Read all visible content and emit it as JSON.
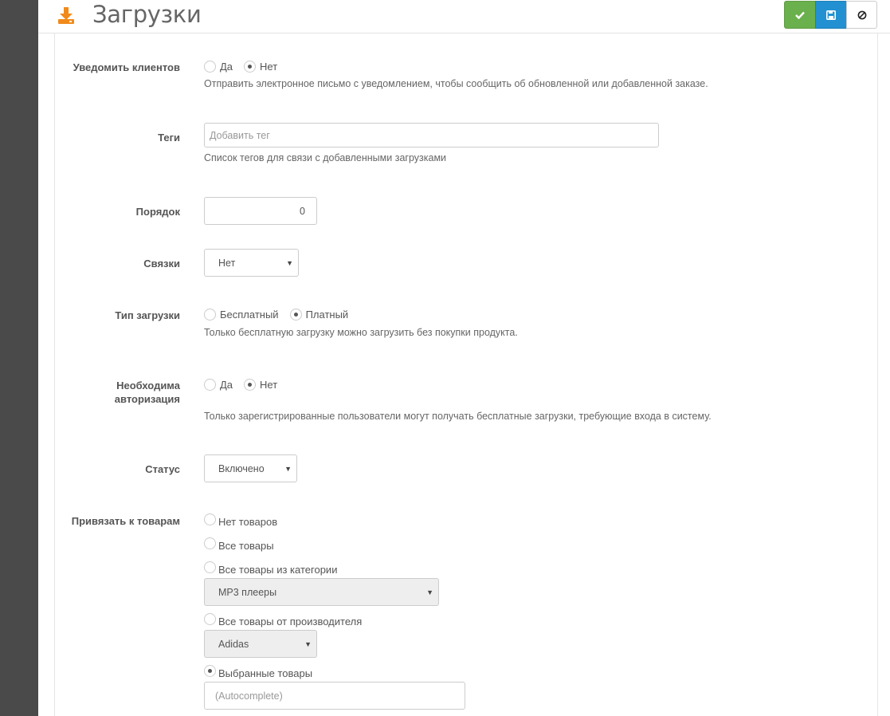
{
  "page": {
    "title": "Загрузки"
  },
  "toolbar": {
    "ok_icon": "check-icon",
    "save_icon": "floppy-icon",
    "cancel_icon": "ban-icon"
  },
  "colors": {
    "ok": "#6ab04c",
    "save": "#2391d1",
    "accent": "#f18a1a",
    "sidebar": "#4a4a4a"
  },
  "notify": {
    "label": "Уведомить клиентов",
    "yes": "Да",
    "no": "Нет",
    "selected": "no",
    "help": "Отправить электронное письмо с уведомлением, чтобы сообщить об обновленной или добавленной заказе."
  },
  "tags": {
    "label": "Теги",
    "placeholder": "Добавить тег",
    "help": "Список тегов для связи с добавленными загрузками"
  },
  "order": {
    "label": "Порядок",
    "value": "0"
  },
  "links": {
    "label": "Связки",
    "value": "Нет"
  },
  "type": {
    "label": "Тип загрузки",
    "free": "Бесплатный",
    "paid": "Платный",
    "selected": "paid",
    "help": "Только бесплатную загрузку можно загрузить без покупки продукта."
  },
  "auth": {
    "label_line1": "Необходима",
    "label_line2": "авторизация",
    "yes": "Да",
    "no": "Нет",
    "selected": "no",
    "help": "Только зарегистрированные пользователи могут получать бесплатные загрузки, требующие входа в систему."
  },
  "status": {
    "label": "Статус",
    "value": "Включено"
  },
  "products": {
    "label": "Привязать к товарам",
    "none": "Нет товаров",
    "all": "Все товары",
    "category": "Все товары из категории",
    "category_value": "MP3 плееры",
    "manufacturer": "Все товары от производителя",
    "manufacturer_value": "Adidas",
    "selected_products": "Выбранные товары",
    "autocomplete_placeholder": "(Autocomplete)",
    "selected": "selected_products"
  }
}
